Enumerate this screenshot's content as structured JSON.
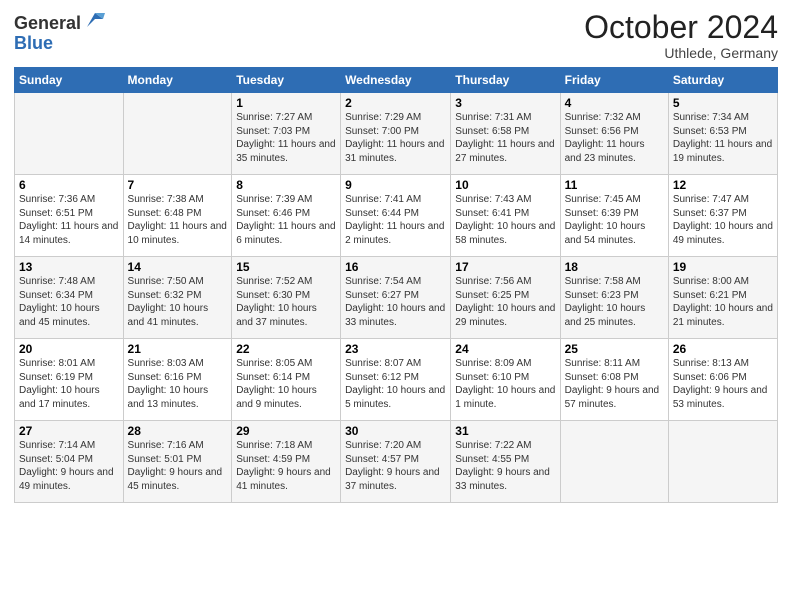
{
  "header": {
    "logo_general": "General",
    "logo_blue": "Blue",
    "month_title": "October 2024",
    "location": "Uthlede, Germany"
  },
  "days_of_week": [
    "Sunday",
    "Monday",
    "Tuesday",
    "Wednesday",
    "Thursday",
    "Friday",
    "Saturday"
  ],
  "weeks": [
    [
      {
        "day": "",
        "info": ""
      },
      {
        "day": "",
        "info": ""
      },
      {
        "day": "1",
        "info": "Sunrise: 7:27 AM\nSunset: 7:03 PM\nDaylight: 11 hours and 35 minutes."
      },
      {
        "day": "2",
        "info": "Sunrise: 7:29 AM\nSunset: 7:00 PM\nDaylight: 11 hours and 31 minutes."
      },
      {
        "day": "3",
        "info": "Sunrise: 7:31 AM\nSunset: 6:58 PM\nDaylight: 11 hours and 27 minutes."
      },
      {
        "day": "4",
        "info": "Sunrise: 7:32 AM\nSunset: 6:56 PM\nDaylight: 11 hours and 23 minutes."
      },
      {
        "day": "5",
        "info": "Sunrise: 7:34 AM\nSunset: 6:53 PM\nDaylight: 11 hours and 19 minutes."
      }
    ],
    [
      {
        "day": "6",
        "info": "Sunrise: 7:36 AM\nSunset: 6:51 PM\nDaylight: 11 hours and 14 minutes."
      },
      {
        "day": "7",
        "info": "Sunrise: 7:38 AM\nSunset: 6:48 PM\nDaylight: 11 hours and 10 minutes."
      },
      {
        "day": "8",
        "info": "Sunrise: 7:39 AM\nSunset: 6:46 PM\nDaylight: 11 hours and 6 minutes."
      },
      {
        "day": "9",
        "info": "Sunrise: 7:41 AM\nSunset: 6:44 PM\nDaylight: 11 hours and 2 minutes."
      },
      {
        "day": "10",
        "info": "Sunrise: 7:43 AM\nSunset: 6:41 PM\nDaylight: 10 hours and 58 minutes."
      },
      {
        "day": "11",
        "info": "Sunrise: 7:45 AM\nSunset: 6:39 PM\nDaylight: 10 hours and 54 minutes."
      },
      {
        "day": "12",
        "info": "Sunrise: 7:47 AM\nSunset: 6:37 PM\nDaylight: 10 hours and 49 minutes."
      }
    ],
    [
      {
        "day": "13",
        "info": "Sunrise: 7:48 AM\nSunset: 6:34 PM\nDaylight: 10 hours and 45 minutes."
      },
      {
        "day": "14",
        "info": "Sunrise: 7:50 AM\nSunset: 6:32 PM\nDaylight: 10 hours and 41 minutes."
      },
      {
        "day": "15",
        "info": "Sunrise: 7:52 AM\nSunset: 6:30 PM\nDaylight: 10 hours and 37 minutes."
      },
      {
        "day": "16",
        "info": "Sunrise: 7:54 AM\nSunset: 6:27 PM\nDaylight: 10 hours and 33 minutes."
      },
      {
        "day": "17",
        "info": "Sunrise: 7:56 AM\nSunset: 6:25 PM\nDaylight: 10 hours and 29 minutes."
      },
      {
        "day": "18",
        "info": "Sunrise: 7:58 AM\nSunset: 6:23 PM\nDaylight: 10 hours and 25 minutes."
      },
      {
        "day": "19",
        "info": "Sunrise: 8:00 AM\nSunset: 6:21 PM\nDaylight: 10 hours and 21 minutes."
      }
    ],
    [
      {
        "day": "20",
        "info": "Sunrise: 8:01 AM\nSunset: 6:19 PM\nDaylight: 10 hours and 17 minutes."
      },
      {
        "day": "21",
        "info": "Sunrise: 8:03 AM\nSunset: 6:16 PM\nDaylight: 10 hours and 13 minutes."
      },
      {
        "day": "22",
        "info": "Sunrise: 8:05 AM\nSunset: 6:14 PM\nDaylight: 10 hours and 9 minutes."
      },
      {
        "day": "23",
        "info": "Sunrise: 8:07 AM\nSunset: 6:12 PM\nDaylight: 10 hours and 5 minutes."
      },
      {
        "day": "24",
        "info": "Sunrise: 8:09 AM\nSunset: 6:10 PM\nDaylight: 10 hours and 1 minute."
      },
      {
        "day": "25",
        "info": "Sunrise: 8:11 AM\nSunset: 6:08 PM\nDaylight: 9 hours and 57 minutes."
      },
      {
        "day": "26",
        "info": "Sunrise: 8:13 AM\nSunset: 6:06 PM\nDaylight: 9 hours and 53 minutes."
      }
    ],
    [
      {
        "day": "27",
        "info": "Sunrise: 7:14 AM\nSunset: 5:04 PM\nDaylight: 9 hours and 49 minutes."
      },
      {
        "day": "28",
        "info": "Sunrise: 7:16 AM\nSunset: 5:01 PM\nDaylight: 9 hours and 45 minutes."
      },
      {
        "day": "29",
        "info": "Sunrise: 7:18 AM\nSunset: 4:59 PM\nDaylight: 9 hours and 41 minutes."
      },
      {
        "day": "30",
        "info": "Sunrise: 7:20 AM\nSunset: 4:57 PM\nDaylight: 9 hours and 37 minutes."
      },
      {
        "day": "31",
        "info": "Sunrise: 7:22 AM\nSunset: 4:55 PM\nDaylight: 9 hours and 33 minutes."
      },
      {
        "day": "",
        "info": ""
      },
      {
        "day": "",
        "info": ""
      }
    ]
  ]
}
